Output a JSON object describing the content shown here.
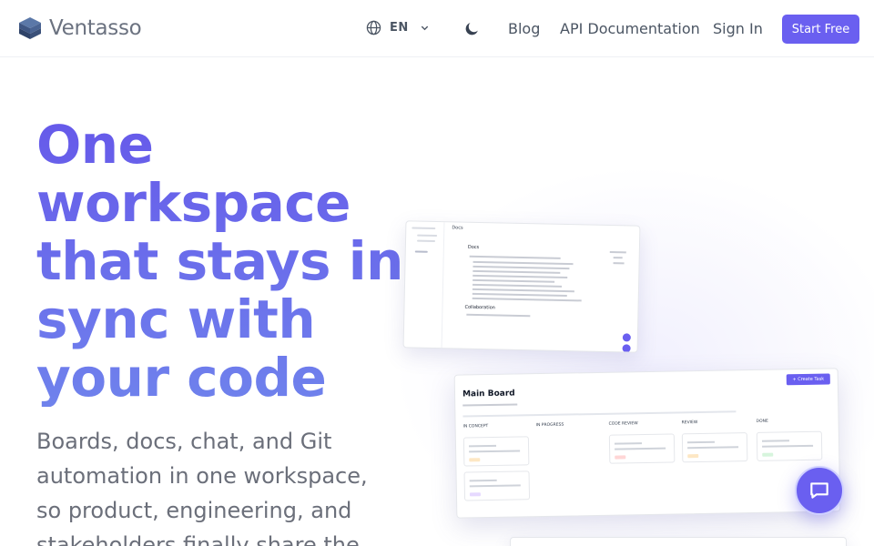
{
  "nav": {
    "brand": "Ventasso",
    "language": "EN",
    "links": {
      "blog": "Blog",
      "api_docs": "API Documentation",
      "sign_in": "Sign In"
    },
    "cta": "Start Free"
  },
  "hero": {
    "title_lines": [
      "One",
      "workspace",
      "that stays in",
      "sync with",
      "your code"
    ],
    "subtitle_lines": [
      "Boards, docs, chat, and Git",
      "automation in one workspace,",
      "so product, engineering, and",
      "stakeholders finally share the"
    ]
  },
  "docs_preview": {
    "page_title": "Docs",
    "heading": "Docs",
    "section_heading": "Collaboration"
  },
  "board_preview": {
    "title": "Main Board",
    "create_button": "+ Create Task",
    "columns": [
      "IN CONCEPT",
      "IN PROGRESS",
      "CODE REVIEW",
      "REVIEW",
      "DONE"
    ]
  },
  "colors": {
    "accent": "#6a5ff0",
    "title_gradient_top": "#6659ea",
    "title_gradient_bottom": "#6f82ec",
    "text": "#4b5563"
  },
  "icons": {
    "language": "globe-icon",
    "theme": "moon-icon",
    "chat": "chat-bubble-icon"
  }
}
